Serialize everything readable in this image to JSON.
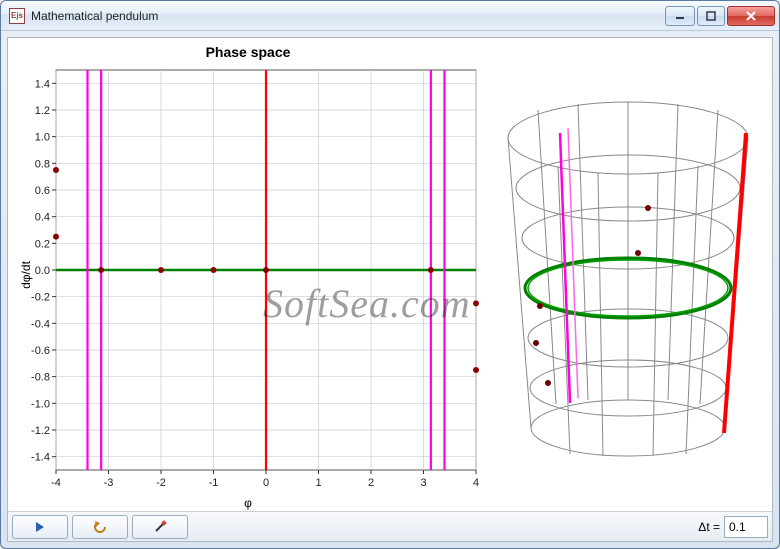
{
  "window": {
    "app_icon_text": "Ejs",
    "title": "Mathematical pendulum"
  },
  "chart": {
    "title": "Phase space",
    "xlabel": "φ",
    "ylabel": "dφ/dt"
  },
  "chart_data": {
    "type": "scatter",
    "title": "Phase space",
    "xlabel": "φ",
    "ylabel": "dφ/dt",
    "xlim": [
      -4,
      4
    ],
    "ylim": [
      -1.5,
      1.5
    ],
    "xticks": [
      -4,
      -3,
      -2,
      -1,
      0,
      1,
      2,
      3,
      4
    ],
    "yticks": [
      -1.4,
      -1.2,
      -1.0,
      -0.8,
      -0.6,
      -0.4,
      -0.2,
      -0.0,
      0.2,
      0.4,
      0.6,
      0.8,
      1.0,
      1.2,
      1.4
    ],
    "vertical_lines": [
      {
        "x": -3.4,
        "color": "#ff00e0"
      },
      {
        "x": -3.14,
        "color": "#ff00e0"
      },
      {
        "x": 0.0,
        "color": "#ff0000"
      },
      {
        "x": 3.14,
        "color": "#ff00e0"
      },
      {
        "x": 3.4,
        "color": "#ff00e0"
      }
    ],
    "horizontal_lines": [
      {
        "y": 0.0,
        "color": "#008000"
      }
    ],
    "points": [
      {
        "x": -4.0,
        "y": 0.75,
        "color": "#8b0000"
      },
      {
        "x": -4.0,
        "y": 0.25,
        "color": "#8b0000"
      },
      {
        "x": -3.14,
        "y": 0.0,
        "color": "#8b0000"
      },
      {
        "x": -2.0,
        "y": 0.0,
        "color": "#8b0000"
      },
      {
        "x": -1.0,
        "y": 0.0,
        "color": "#8b0000"
      },
      {
        "x": 0.0,
        "y": 0.0,
        "color": "#8b0000"
      },
      {
        "x": 3.14,
        "y": 0.0,
        "color": "#8b0000"
      },
      {
        "x": 4.0,
        "y": -0.25,
        "color": "#8b0000"
      },
      {
        "x": 4.0,
        "y": -0.75,
        "color": "#8b0000"
      }
    ]
  },
  "toolbar": {
    "play_label": "",
    "undo_label": "",
    "brush_label": "",
    "dt_label": "Δt =",
    "dt_value": "0.1"
  },
  "watermark": "SoftSea.com"
}
